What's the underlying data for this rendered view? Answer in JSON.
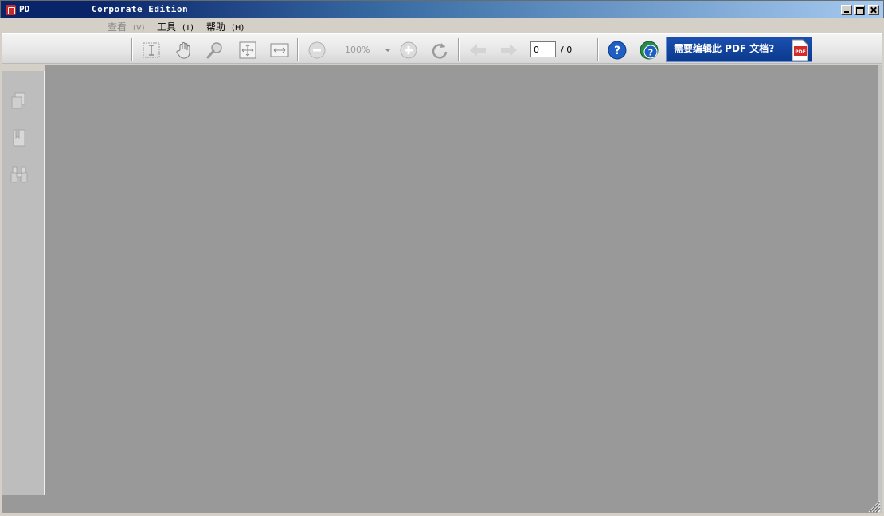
{
  "window": {
    "app_short": "PD",
    "title": "Corporate Edition"
  },
  "menu": {
    "items": [
      {
        "label": "查看",
        "key": "(V)",
        "disabled": true
      },
      {
        "label": "工具",
        "key": "(T)",
        "disabled": false
      },
      {
        "label": "帮助",
        "key": "(H)",
        "disabled": false
      }
    ]
  },
  "toolbar": {
    "zoom": "100%",
    "page_current": "0",
    "page_total": "/ 0",
    "ad_text": "需要编辑此 PDF 文档?",
    "icons": [
      "select-text-icon",
      "hand-tool-icon",
      "zoom-tool-icon",
      "fit-page-icon",
      "fit-width-icon",
      "zoom-out-icon",
      "zoom-in-icon",
      "rotate-icon",
      "prev-page-icon",
      "next-page-icon",
      "help-icon",
      "online-help-icon"
    ]
  },
  "sidebar": {
    "icons": [
      "pages-icon",
      "bookmarks-icon",
      "search-binoculars-icon"
    ]
  },
  "colors": {
    "titlebar_start": "#0a246a",
    "document_bg": "#999999",
    "ad_bg": "#0b3a8c"
  }
}
